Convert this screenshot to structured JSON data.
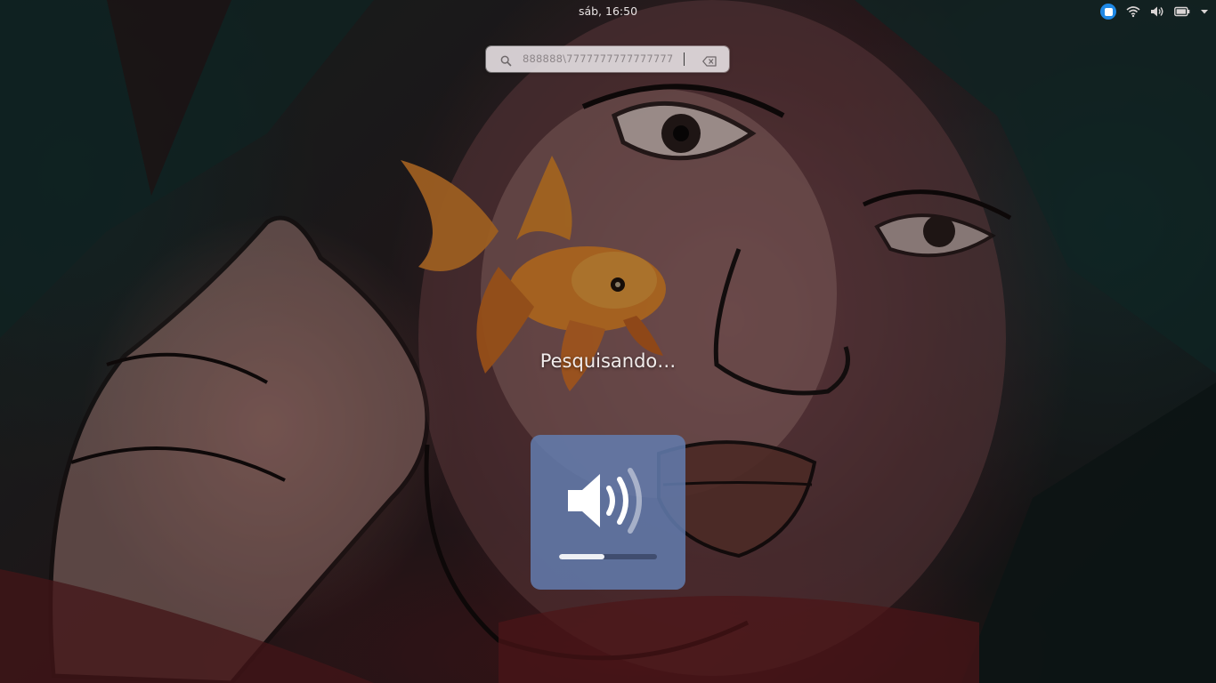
{
  "topbar": {
    "clock": "sáb, 16:50",
    "tray": {
      "app_indicator_icon": "ubuntu-updates-icon",
      "network_icon": "wifi-icon",
      "volume_icon": "speaker-icon",
      "battery_icon": "battery-icon",
      "menu_icon": "chevron-down-icon"
    }
  },
  "search": {
    "value": "888888\\7777777777777777",
    "icon": "search-icon",
    "clear_icon": "backspace-clear-icon"
  },
  "status_text": "Pesquisando…",
  "osd": {
    "icon": "volume-high-icon",
    "level": 0.46
  },
  "colors": {
    "osd_background": "#637daf",
    "search_background": "#e1dade",
    "badge": "#1e88e5"
  }
}
